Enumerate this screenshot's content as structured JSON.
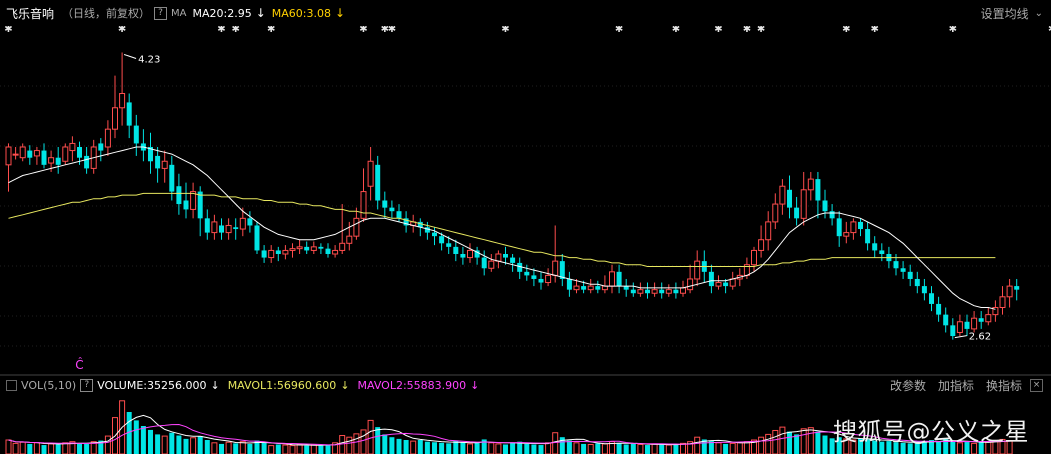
{
  "header": {
    "stock_name": "飞乐音响",
    "period": "（日线，前复权）",
    "help": "?",
    "ma_label": "MA",
    "ma20_text": "MA20:2.95",
    "ma60_text": "MA60:3.08",
    "down_arrow": "↓",
    "settings": "设置均线"
  },
  "volume_header": {
    "indicator": "VOL(5,10)",
    "volume_text": "VOLUME:35256.000",
    "mavol1_text": "MAVOL1:56960.600",
    "mavol2_text": "MAVOL2:55883.900",
    "down_arrow": "↓",
    "btn_change": "改参数",
    "btn_add": "加指标",
    "btn_switch": "换指标"
  },
  "annotations": {
    "high_label": "4.23",
    "low_label": "2.62",
    "marker_label": "Ĉ",
    "star": "✱"
  },
  "watermark": "搜狐号@公义之星",
  "colors": {
    "up": "#ff4d4d",
    "down": "#00e5e5",
    "ma20": "#ffffff",
    "ma60": "#e8e860",
    "mavol1": "#ffffff",
    "mavol2": "#ff44ff",
    "ma20_label": "#ffffff",
    "ma60_label": "#ffd000",
    "vol_label": "#ffffff",
    "mavol1_label": "#e8e860",
    "mavol2_label": "#ff44ff",
    "marker": "#ff44ff"
  },
  "chart_data": {
    "type": "candlestick",
    "price_range": [
      2.5,
      4.3
    ],
    "high": 4.23,
    "low": 2.62,
    "candles": [
      [
        3.6,
        3.7,
        3.45,
        3.72
      ],
      [
        3.66,
        3.66,
        3.63,
        3.7
      ],
      [
        3.64,
        3.7,
        3.62,
        3.72
      ],
      [
        3.68,
        3.64,
        3.6,
        3.71
      ],
      [
        3.65,
        3.68,
        3.6,
        3.7
      ],
      [
        3.68,
        3.6,
        3.58,
        3.72
      ],
      [
        3.61,
        3.64,
        3.56,
        3.68
      ],
      [
        3.64,
        3.6,
        3.55,
        3.7
      ],
      [
        3.62,
        3.7,
        3.6,
        3.72
      ],
      [
        3.68,
        3.72,
        3.62,
        3.76
      ],
      [
        3.7,
        3.64,
        3.6,
        3.73
      ],
      [
        3.65,
        3.58,
        3.55,
        3.7
      ],
      [
        3.58,
        3.7,
        3.55,
        3.74
      ],
      [
        3.72,
        3.68,
        3.62,
        3.75
      ],
      [
        3.7,
        3.8,
        3.65,
        3.85
      ],
      [
        3.8,
        3.92,
        3.75,
        4.1
      ],
      [
        3.92,
        4.0,
        3.82,
        4.23
      ],
      [
        3.95,
        3.82,
        3.75,
        4.0
      ],
      [
        3.82,
        3.72,
        3.65,
        3.88
      ],
      [
        3.72,
        3.68,
        3.62,
        3.8
      ],
      [
        3.7,
        3.62,
        3.55,
        3.78
      ],
      [
        3.65,
        3.58,
        3.5,
        3.7
      ],
      [
        3.58,
        3.62,
        3.5,
        3.68
      ],
      [
        3.6,
        3.45,
        3.4,
        3.65
      ],
      [
        3.48,
        3.38,
        3.32,
        3.55
      ],
      [
        3.4,
        3.35,
        3.3,
        3.5
      ],
      [
        3.35,
        3.45,
        3.3,
        3.5
      ],
      [
        3.45,
        3.3,
        3.2,
        3.48
      ],
      [
        3.3,
        3.22,
        3.18,
        3.35
      ],
      [
        3.22,
        3.28,
        3.18,
        3.32
      ],
      [
        3.26,
        3.22,
        3.18,
        3.3
      ],
      [
        3.22,
        3.26,
        3.18,
        3.3
      ],
      [
        3.25,
        3.24,
        3.18,
        3.3
      ],
      [
        3.24,
        3.3,
        3.2,
        3.36
      ],
      [
        3.3,
        3.26,
        3.22,
        3.34
      ],
      [
        3.26,
        3.12,
        3.1,
        3.28
      ],
      [
        3.12,
        3.08,
        3.05,
        3.15
      ],
      [
        3.08,
        3.12,
        3.05,
        3.15
      ],
      [
        3.12,
        3.1,
        3.06,
        3.14
      ],
      [
        3.1,
        3.12,
        3.07,
        3.15
      ],
      [
        3.12,
        3.13,
        3.08,
        3.16
      ],
      [
        3.13,
        3.14,
        3.1,
        3.18
      ],
      [
        3.14,
        3.12,
        3.1,
        3.17
      ],
      [
        3.12,
        3.14,
        3.1,
        3.17
      ],
      [
        3.14,
        3.13,
        3.1,
        3.16
      ],
      [
        3.13,
        3.1,
        3.08,
        3.16
      ],
      [
        3.1,
        3.12,
        3.08,
        3.15
      ],
      [
        3.12,
        3.16,
        3.1,
        3.38
      ],
      [
        3.16,
        3.2,
        3.12,
        3.28
      ],
      [
        3.2,
        3.3,
        3.18,
        3.36
      ],
      [
        3.3,
        3.45,
        3.28,
        3.58
      ],
      [
        3.48,
        3.62,
        3.4,
        3.7
      ],
      [
        3.6,
        3.4,
        3.35,
        3.65
      ],
      [
        3.4,
        3.36,
        3.3,
        3.45
      ],
      [
        3.36,
        3.34,
        3.3,
        3.4
      ],
      [
        3.34,
        3.3,
        3.28,
        3.38
      ],
      [
        3.3,
        3.26,
        3.22,
        3.34
      ],
      [
        3.26,
        3.28,
        3.22,
        3.32
      ],
      [
        3.28,
        3.25,
        3.2,
        3.3
      ],
      [
        3.25,
        3.22,
        3.18,
        3.28
      ],
      [
        3.22,
        3.2,
        3.15,
        3.25
      ],
      [
        3.2,
        3.16,
        3.12,
        3.22
      ],
      [
        3.16,
        3.14,
        3.1,
        3.2
      ],
      [
        3.14,
        3.1,
        3.06,
        3.18
      ],
      [
        3.1,
        3.08,
        3.04,
        3.14
      ],
      [
        3.08,
        3.12,
        3.05,
        3.16
      ],
      [
        3.12,
        3.08,
        3.04,
        3.14
      ],
      [
        3.08,
        3.02,
        2.98,
        3.12
      ],
      [
        3.02,
        3.06,
        3.0,
        3.1
      ],
      [
        3.06,
        3.1,
        3.02,
        3.12
      ],
      [
        3.1,
        3.08,
        3.04,
        3.14
      ],
      [
        3.08,
        3.05,
        3.0,
        3.1
      ],
      [
        3.05,
        3.0,
        2.96,
        3.08
      ],
      [
        3.0,
        2.98,
        2.95,
        3.04
      ],
      [
        2.98,
        2.96,
        2.92,
        3.02
      ],
      [
        2.96,
        2.94,
        2.9,
        3.0
      ],
      [
        2.94,
        2.98,
        2.92,
        3.02
      ],
      [
        2.98,
        3.06,
        2.94,
        3.26
      ],
      [
        3.06,
        2.96,
        2.92,
        3.1
      ],
      [
        2.96,
        2.9,
        2.86,
        3.0
      ],
      [
        2.9,
        2.92,
        2.88,
        2.96
      ],
      [
        2.92,
        2.9,
        2.88,
        2.95
      ],
      [
        2.9,
        2.92,
        2.88,
        2.96
      ],
      [
        2.92,
        2.9,
        2.88,
        2.95
      ],
      [
        2.9,
        2.92,
        2.88,
        2.98
      ],
      [
        2.92,
        3.0,
        2.88,
        3.04
      ],
      [
        3.0,
        2.92,
        2.88,
        3.04
      ],
      [
        2.92,
        2.9,
        2.86,
        2.96
      ],
      [
        2.9,
        2.88,
        2.86,
        2.94
      ],
      [
        2.88,
        2.9,
        2.86,
        2.94
      ],
      [
        2.9,
        2.88,
        2.85,
        2.94
      ],
      [
        2.88,
        2.9,
        2.86,
        2.94
      ],
      [
        2.9,
        2.88,
        2.85,
        2.94
      ],
      [
        2.88,
        2.9,
        2.86,
        2.93
      ],
      [
        2.9,
        2.88,
        2.85,
        2.94
      ],
      [
        2.88,
        2.91,
        2.86,
        2.95
      ],
      [
        2.9,
        2.96,
        2.88,
        3.04
      ],
      [
        2.96,
        3.06,
        2.92,
        3.12
      ],
      [
        3.06,
        3.0,
        2.94,
        3.12
      ],
      [
        3.0,
        2.92,
        2.88,
        3.04
      ],
      [
        2.92,
        2.94,
        2.9,
        2.98
      ],
      [
        2.94,
        2.92,
        2.88,
        2.96
      ],
      [
        2.92,
        2.96,
        2.9,
        3.0
      ],
      [
        2.96,
        2.98,
        2.92,
        3.02
      ],
      [
        2.98,
        3.04,
        2.96,
        3.08
      ],
      [
        3.04,
        3.12,
        3.0,
        3.14
      ],
      [
        3.12,
        3.18,
        3.08,
        3.26
      ],
      [
        3.18,
        3.28,
        3.12,
        3.34
      ],
      [
        3.28,
        3.38,
        3.24,
        3.44
      ],
      [
        3.38,
        3.48,
        3.32,
        3.52
      ],
      [
        3.46,
        3.36,
        3.3,
        3.54
      ],
      [
        3.36,
        3.3,
        3.26,
        3.42
      ],
      [
        3.3,
        3.46,
        3.26,
        3.56
      ],
      [
        3.46,
        3.52,
        3.4,
        3.56
      ],
      [
        3.52,
        3.4,
        3.3,
        3.56
      ],
      [
        3.4,
        3.34,
        3.3,
        3.46
      ],
      [
        3.34,
        3.3,
        3.26,
        3.38
      ],
      [
        3.3,
        3.2,
        3.14,
        3.34
      ],
      [
        3.2,
        3.22,
        3.16,
        3.28
      ],
      [
        3.22,
        3.28,
        3.18,
        3.3
      ],
      [
        3.28,
        3.24,
        3.2,
        3.3
      ],
      [
        3.24,
        3.16,
        3.12,
        3.28
      ],
      [
        3.16,
        3.12,
        3.08,
        3.2
      ],
      [
        3.12,
        3.1,
        3.06,
        3.16
      ],
      [
        3.1,
        3.06,
        3.02,
        3.14
      ],
      [
        3.06,
        3.02,
        2.98,
        3.1
      ],
      [
        3.02,
        3.0,
        2.96,
        3.06
      ],
      [
        3.0,
        2.96,
        2.92,
        3.04
      ],
      [
        2.96,
        2.92,
        2.88,
        3.0
      ],
      [
        2.92,
        2.88,
        2.84,
        2.96
      ],
      [
        2.88,
        2.82,
        2.78,
        2.92
      ],
      [
        2.82,
        2.76,
        2.72,
        2.86
      ],
      [
        2.76,
        2.7,
        2.66,
        2.8
      ],
      [
        2.7,
        2.64,
        2.62,
        2.74
      ],
      [
        2.66,
        2.72,
        2.64,
        2.76
      ],
      [
        2.72,
        2.68,
        2.64,
        2.76
      ],
      [
        2.68,
        2.74,
        2.66,
        2.78
      ],
      [
        2.74,
        2.72,
        2.68,
        2.78
      ],
      [
        2.72,
        2.76,
        2.7,
        2.8
      ],
      [
        2.76,
        2.8,
        2.72,
        2.84
      ],
      [
        2.8,
        2.86,
        2.76,
        2.92
      ],
      [
        2.86,
        2.92,
        2.8,
        2.96
      ],
      [
        2.92,
        2.9,
        2.84,
        2.96
      ]
    ],
    "volumes": [
      50,
      38,
      42,
      36,
      40,
      32,
      36,
      34,
      40,
      44,
      38,
      36,
      44,
      48,
      64,
      130,
      190,
      150,
      120,
      100,
      86,
      70,
      64,
      76,
      66,
      54,
      58,
      64,
      50,
      40,
      36,
      42,
      38,
      44,
      36,
      48,
      40,
      30,
      34,
      32,
      30,
      34,
      30,
      32,
      30,
      34,
      40,
      66,
      60,
      72,
      86,
      120,
      96,
      70,
      60,
      54,
      50,
      46,
      50,
      44,
      42,
      40,
      38,
      46,
      42,
      36,
      40,
      52,
      40,
      36,
      34,
      40,
      44,
      36,
      34,
      32,
      40,
      76,
      60,
      48,
      40,
      36,
      34,
      38,
      36,
      44,
      40,
      34,
      36,
      34,
      32,
      36,
      34,
      32,
      34,
      38,
      44,
      60,
      52,
      46,
      40,
      36,
      38,
      40,
      44,
      50,
      60,
      70,
      84,
      96,
      80,
      70,
      90,
      94,
      80,
      66,
      56,
      60,
      54,
      50,
      56,
      52,
      48,
      44,
      46,
      42,
      40,
      38,
      44,
      46,
      50,
      44,
      52,
      48,
      40,
      44,
      38,
      42,
      44,
      48,
      52,
      46
    ],
    "ma20": [
      3.5,
      3.52,
      3.54,
      3.55,
      3.56,
      3.57,
      3.58,
      3.59,
      3.6,
      3.61,
      3.62,
      3.63,
      3.64,
      3.65,
      3.66,
      3.67,
      3.68,
      3.69,
      3.7,
      3.7,
      3.69,
      3.68,
      3.67,
      3.66,
      3.64,
      3.62,
      3.6,
      3.57,
      3.54,
      3.5,
      3.46,
      3.42,
      3.38,
      3.34,
      3.31,
      3.28,
      3.25,
      3.23,
      3.21,
      3.2,
      3.19,
      3.18,
      3.18,
      3.18,
      3.19,
      3.2,
      3.21,
      3.23,
      3.25,
      3.27,
      3.29,
      3.3,
      3.3,
      3.3,
      3.29,
      3.28,
      3.27,
      3.26,
      3.25,
      3.24,
      3.23,
      3.21,
      3.19,
      3.17,
      3.15,
      3.13,
      3.11,
      3.09,
      3.07,
      3.06,
      3.05,
      3.04,
      3.03,
      3.02,
      3.01,
      3.0,
      2.99,
      2.98,
      2.97,
      2.96,
      2.95,
      2.94,
      2.93,
      2.93,
      2.92,
      2.92,
      2.92,
      2.92,
      2.92,
      2.91,
      2.91,
      2.91,
      2.91,
      2.91,
      2.91,
      2.91,
      2.92,
      2.93,
      2.94,
      2.95,
      2.95,
      2.95,
      2.96,
      2.97,
      2.98,
      3.0,
      3.03,
      3.07,
      3.12,
      3.17,
      3.22,
      3.25,
      3.28,
      3.3,
      3.32,
      3.33,
      3.33,
      3.33,
      3.32,
      3.31,
      3.3,
      3.28,
      3.26,
      3.24,
      3.22,
      3.19,
      3.16,
      3.12,
      3.08,
      3.04,
      3.0,
      2.96,
      2.92,
      2.88,
      2.85,
      2.83,
      2.81,
      2.8,
      2.8,
      2.79
    ],
    "ma60": [
      3.3,
      3.31,
      3.32,
      3.33,
      3.34,
      3.35,
      3.36,
      3.37,
      3.38,
      3.39,
      3.39,
      3.4,
      3.41,
      3.41,
      3.42,
      3.42,
      3.43,
      3.43,
      3.43,
      3.44,
      3.44,
      3.44,
      3.44,
      3.44,
      3.44,
      3.44,
      3.44,
      3.43,
      3.43,
      3.43,
      3.42,
      3.42,
      3.42,
      3.41,
      3.41,
      3.41,
      3.4,
      3.4,
      3.39,
      3.39,
      3.39,
      3.38,
      3.38,
      3.37,
      3.37,
      3.36,
      3.35,
      3.35,
      3.34,
      3.34,
      3.33,
      3.33,
      3.32,
      3.31,
      3.3,
      3.3,
      3.29,
      3.28,
      3.27,
      3.26,
      3.25,
      3.24,
      3.23,
      3.22,
      3.21,
      3.2,
      3.19,
      3.18,
      3.17,
      3.16,
      3.15,
      3.14,
      3.13,
      3.12,
      3.11,
      3.11,
      3.1,
      3.09,
      3.09,
      3.08,
      3.08,
      3.07,
      3.07,
      3.06,
      3.06,
      3.05,
      3.05,
      3.04,
      3.04,
      3.04,
      3.03,
      3.03,
      3.03,
      3.03,
      3.03,
      3.03,
      3.03,
      3.03,
      3.03,
      3.03,
      3.03,
      3.03,
      3.03,
      3.03,
      3.03,
      3.03,
      3.04,
      3.04,
      3.04,
      3.05,
      3.05,
      3.06,
      3.06,
      3.07,
      3.07,
      3.07,
      3.08,
      3.08,
      3.08,
      3.08,
      3.08,
      3.08,
      3.08,
      3.08,
      3.08,
      3.08,
      3.08,
      3.08,
      3.08,
      3.08,
      3.08,
      3.08,
      3.08,
      3.08,
      3.08,
      3.08,
      3.08,
      3.08,
      3.08,
      3.08
    ],
    "star_columns": [
      0,
      16,
      30,
      32,
      37,
      50,
      53,
      54,
      70,
      86,
      94,
      100,
      104,
      106,
      118,
      122,
      133,
      147,
      151,
      153,
      163,
      165,
      170,
      187,
      195,
      202
    ]
  }
}
